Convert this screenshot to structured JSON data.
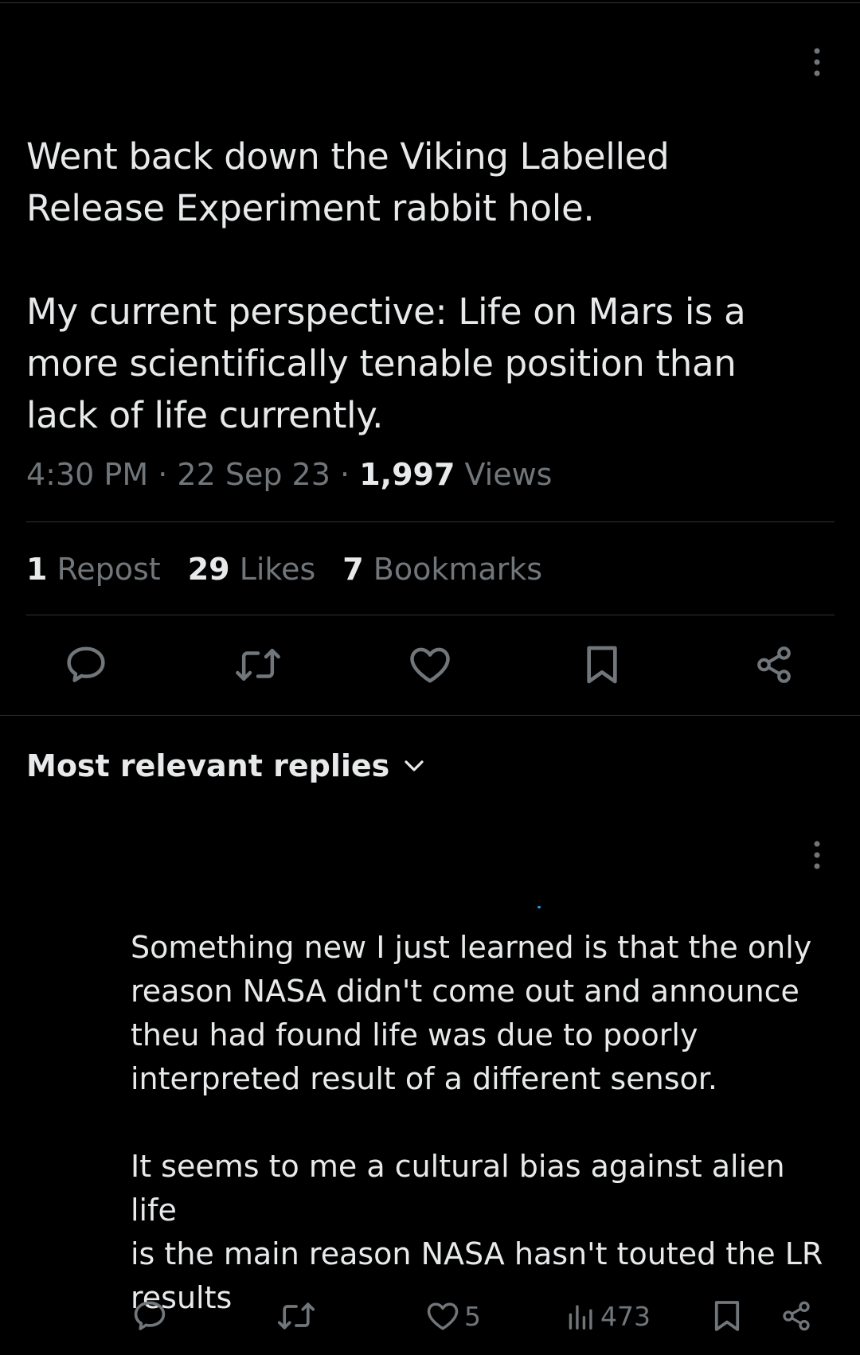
{
  "tweet": {
    "text": "Went back down the Viking Labelled\nRelease Experiment rabbit hole.\n\nMy current perspective: Life on Mars is a\nmore scientifically tenable position than\nlack of life currently.",
    "time": "4:30 PM",
    "date": "22 Sep 23",
    "separator": "·",
    "views_count": "1,997",
    "views_label": "Views"
  },
  "stats": {
    "reposts_count": "1",
    "reposts_label": "Repost",
    "likes_count": "29",
    "likes_label": "Likes",
    "bookmarks_count": "7",
    "bookmarks_label": "Bookmarks"
  },
  "actions": {
    "icons": [
      "reply-icon",
      "repost-icon",
      "like-icon",
      "bookmark-icon",
      "share-icon"
    ]
  },
  "replies_section": {
    "sort_label": "Most relevant replies"
  },
  "reply": {
    "text": "Something new I just learned is that the only\nreason NASA didn't come out and announce\ntheu had found life was due to poorly\ninterpreted result of a different sensor.\n\nIt seems to me a cultural bias against alien life\nis the main reason NASA hasn't touted the LR\nresults",
    "likes_count": "5",
    "views_count": "473"
  },
  "colors": {
    "background": "#000000",
    "text_primary": "#e7e9ea",
    "text_secondary": "#71767b",
    "divider": "#2f3336",
    "accent": "#1d9bf0"
  }
}
